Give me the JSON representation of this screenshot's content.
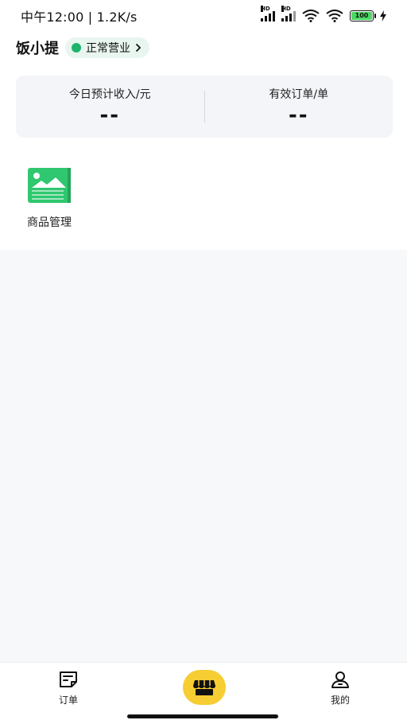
{
  "status_bar": {
    "time_speed": "中午12:00 | 1.2K/s",
    "hd_label": "HD",
    "battery_level": "100"
  },
  "header": {
    "store_name": "饭小提",
    "status_label": "正常营业",
    "status_color": "#1db36b"
  },
  "stats": {
    "income_label": "今日预计收入/元",
    "income_value": "--",
    "orders_label": "有效订单/单",
    "orders_value": "--"
  },
  "grid": [
    {
      "label": "商品管理",
      "icon": "image-icon",
      "icon_color": "#2fc76f"
    }
  ],
  "bottom_nav": {
    "orders_label": "订单",
    "center_icon": "storefront-icon",
    "center_color": "#f6cd33",
    "mine_label": "我的"
  }
}
